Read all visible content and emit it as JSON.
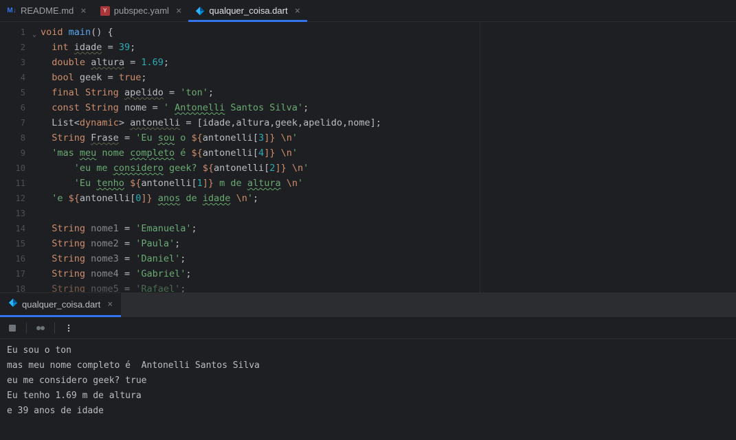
{
  "tabs": [
    {
      "label": "README.md",
      "icon": "md"
    },
    {
      "label": "pubspec.yaml",
      "icon": "yaml"
    },
    {
      "label": "qualquer_coisa.dart",
      "icon": "dart",
      "active": true
    }
  ],
  "lower_tab": {
    "label": "qualquer_coisa.dart"
  },
  "code": {
    "l1": {
      "kw": "void",
      "fn": "main",
      "paren": "() {",
      "indent": ""
    },
    "l2": {
      "indent": "  ",
      "type": "int",
      "id": "idade",
      "eq": " = ",
      "num": "39",
      "semi": ";"
    },
    "l3": {
      "indent": "  ",
      "type": "double",
      "id": "altura",
      "eq": " = ",
      "num": "1.69",
      "semi": ";"
    },
    "l4": {
      "indent": "  ",
      "type": "bool",
      "id": "geek",
      "eq": " = ",
      "bool": "true",
      "semi": ";"
    },
    "l5": {
      "indent": "  ",
      "kw": "final",
      "type": " String ",
      "id": "apelido",
      "eq": " = ",
      "str": "'ton'",
      "semi": ";"
    },
    "l6": {
      "indent": "  ",
      "kw": "const",
      "type": " String ",
      "id": "nome",
      "eq": " = ",
      "q1": "' ",
      "name": "Antonelli",
      "rest": " Santos Silva'",
      "semi": ";"
    },
    "l7": {
      "indent": "  ",
      "type1": "List",
      "lt": "<",
      "type2": "dynamic",
      "gt": "> ",
      "id": "antonelli",
      "eq": " = ",
      "list": "[idade,altura,geek,apelido,nome];"
    },
    "l8": {
      "indent": "  ",
      "type": "String ",
      "id": "Frase",
      "eq": " = ",
      "s1": "'Eu ",
      "s2": "sou",
      "s3": " o ",
      "interp1a": "${",
      "interp1b": "antonelli[",
      "idx": "3",
      "interp1c": "]}",
      "s4": " ",
      "esc": "\\n",
      "q": "'"
    },
    "l9": {
      "indent": "  ",
      "s1": "'mas ",
      "s2": "meu",
      "s3": " nome ",
      "s4": "completo",
      "s5": " é ",
      "interp1a": "${",
      "interp1b": "antonelli[",
      "idx": "4",
      "interp1c": "]}",
      "s6": " ",
      "esc": "\\n",
      "q": "'"
    },
    "l10": {
      "indent": "      ",
      "s1": "'eu me ",
      "s2": "considero",
      "s3": " geek? ",
      "interp1a": "${",
      "interp1b": "antonelli[",
      "idx": "2",
      "interp1c": "]}",
      "s4": " ",
      "esc": "\\n",
      "q": "'"
    },
    "l11": {
      "indent": "      ",
      "s1": "'Eu ",
      "s2": "tenho",
      "s3": " ",
      "interp1a": "${",
      "interp1b": "antonelli[",
      "idx": "1",
      "interp1c": "]}",
      "s4": " m de ",
      "s5": "altura",
      "s6": " ",
      "esc": "\\n",
      "q": "'"
    },
    "l12": {
      "indent": "  ",
      "s1": "'e ",
      "interp1a": "${",
      "interp1b": "antonelli[",
      "idx": "0",
      "interp1c": "]}",
      "s2": " ",
      "s3": "anos",
      "s4": " de ",
      "s5": "idade",
      "s6": " ",
      "esc": "\\n",
      "q": "'",
      "semi": ";"
    },
    "l13": {
      "indent": ""
    },
    "l14": {
      "indent": "  ",
      "type": "String ",
      "id": "nome1",
      "eq": " = ",
      "str": "'Emanuela'",
      "semi": ";"
    },
    "l15": {
      "indent": "  ",
      "type": "String ",
      "id": "nome2",
      "eq": " = ",
      "str": "'Paula'",
      "semi": ";"
    },
    "l16": {
      "indent": "  ",
      "type": "String ",
      "id": "nome3",
      "eq": " = ",
      "str": "'Daniel'",
      "semi": ";"
    },
    "l17": {
      "indent": "  ",
      "type": "String ",
      "id": "nome4",
      "eq": " = ",
      "str": "'Gabriel'",
      "semi": ";"
    },
    "l18": {
      "indent": "  ",
      "type": "String ",
      "id": "nome5",
      "eq": " = ",
      "str": "'Rafael'",
      "semi": ";"
    }
  },
  "line_numbers": [
    "1",
    "2",
    "3",
    "4",
    "5",
    "6",
    "7",
    "8",
    "9",
    "10",
    "11",
    "12",
    "13",
    "14",
    "15",
    "16",
    "17",
    "18"
  ],
  "console": {
    "l1": "Eu sou o ton",
    "l2": "mas meu nome completo é  Antonelli Santos Silva",
    "l3": "eu me considero geek? true",
    "l4": "Eu tenho 1.69 m de altura",
    "l5": "e 39 anos de idade "
  }
}
